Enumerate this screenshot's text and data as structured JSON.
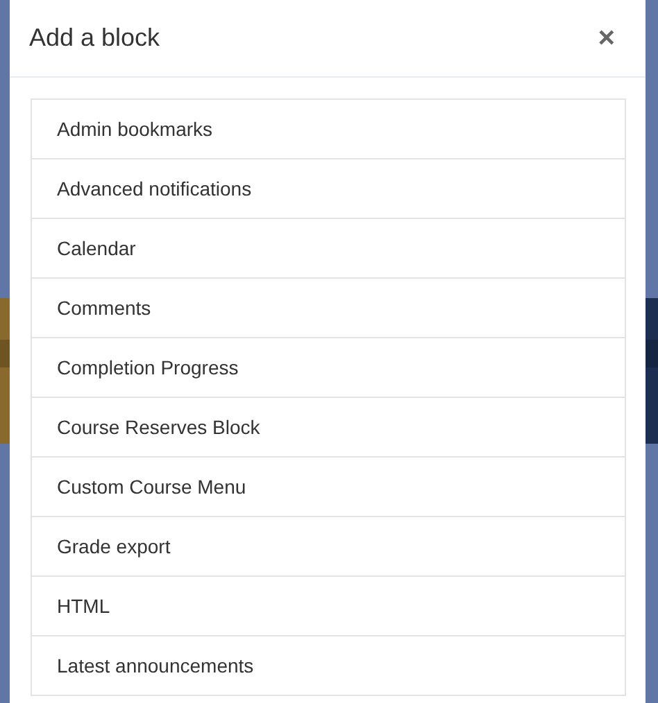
{
  "dialog": {
    "title": "Add a block",
    "close": "×"
  },
  "blocks": [
    {
      "label": "Admin bookmarks"
    },
    {
      "label": "Advanced notifications"
    },
    {
      "label": "Calendar"
    },
    {
      "label": "Comments"
    },
    {
      "label": "Completion Progress"
    },
    {
      "label": "Course Reserves Block"
    },
    {
      "label": "Custom Course Menu"
    },
    {
      "label": "Grade export"
    },
    {
      "label": "HTML"
    },
    {
      "label": "Latest announcements"
    }
  ]
}
